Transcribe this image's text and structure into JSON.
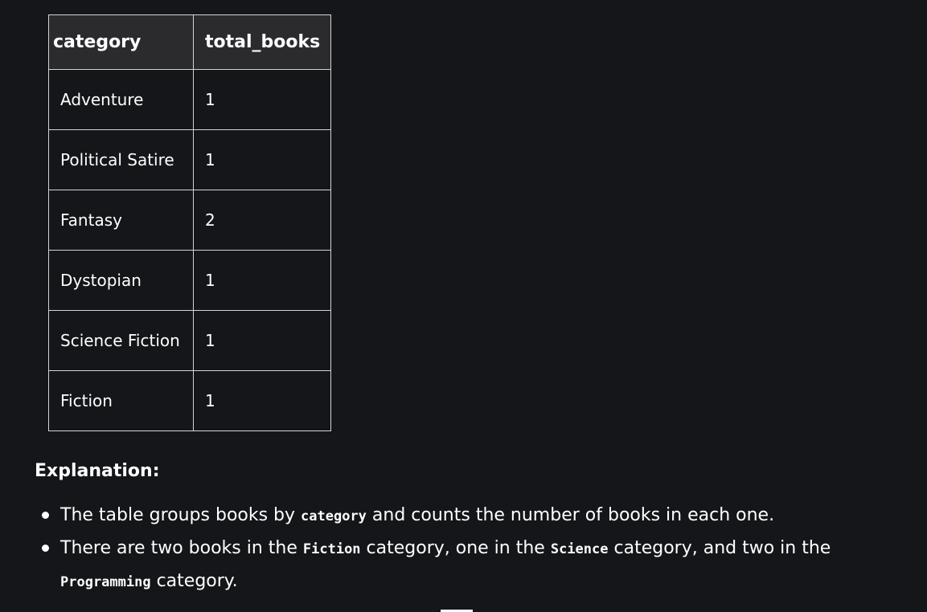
{
  "table": {
    "headers": [
      "category",
      "total_books"
    ],
    "rows": [
      {
        "category": "Adventure",
        "total_books": "1"
      },
      {
        "category": "Political Satire",
        "total_books": "1"
      },
      {
        "category": "Fantasy",
        "total_books": "2"
      },
      {
        "category": "Dystopian",
        "total_books": "1"
      },
      {
        "category": "Science Fiction",
        "total_books": "1"
      },
      {
        "category": "Fiction",
        "total_books": "1"
      }
    ]
  },
  "explanation": {
    "heading": "Explanation:",
    "bullet1": {
      "before": "The table groups books by ",
      "code": "category",
      "after": " and counts the number of books in each one."
    },
    "bullet2": {
      "part1": "There are two books in the ",
      "code1": "Fiction",
      "part2": " category, one in the ",
      "code2": "Science",
      "part3": " category, and two in the ",
      "code3": "Programming",
      "part4": " category."
    }
  },
  "colors": {
    "background": "#151619",
    "header_background": "#2b2b2e",
    "border": "#d4d4d4",
    "text": "#ffffff"
  }
}
